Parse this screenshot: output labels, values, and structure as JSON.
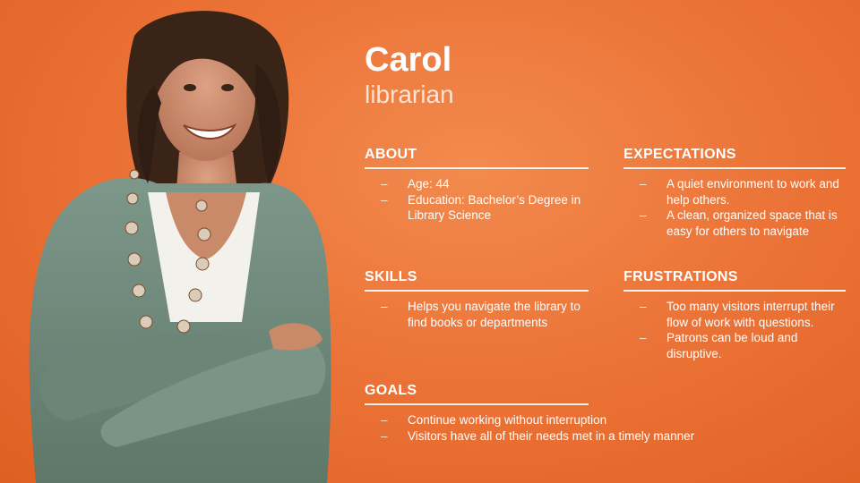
{
  "persona": {
    "name": "Carol",
    "role": "librarian"
  },
  "portrait": {
    "icon": "person-portrait",
    "colors": {
      "cardigan": "#6f8a7b",
      "shirt": "#f3f1ec",
      "hair": "#3a2418",
      "skin": "#c88a68"
    }
  },
  "sections": {
    "about": {
      "title": "ABOUT",
      "items": [
        "Age: 44",
        "Education: Bachelor’s Degree in Library Science"
      ]
    },
    "skills": {
      "title": "SKILLS",
      "items": [
        "Helps you navigate the library to find books or departments"
      ]
    },
    "goals": {
      "title": "GOALS",
      "items": [
        "Continue working without interruption",
        "Visitors have all of their needs met in a timely manner"
      ]
    },
    "expectations": {
      "title": "EXPECTATIONS",
      "items": [
        "A quiet environment to work and help others.",
        "A clean, organized space that is easy for others to navigate"
      ]
    },
    "frustrations": {
      "title": "FRUSTRATIONS",
      "items": [
        "Too many visitors interrupt their flow of work with questions.",
        "Patrons can be loud and disruptive."
      ]
    }
  },
  "theme": {
    "background": "#ec7438",
    "text": "#ffffff"
  }
}
